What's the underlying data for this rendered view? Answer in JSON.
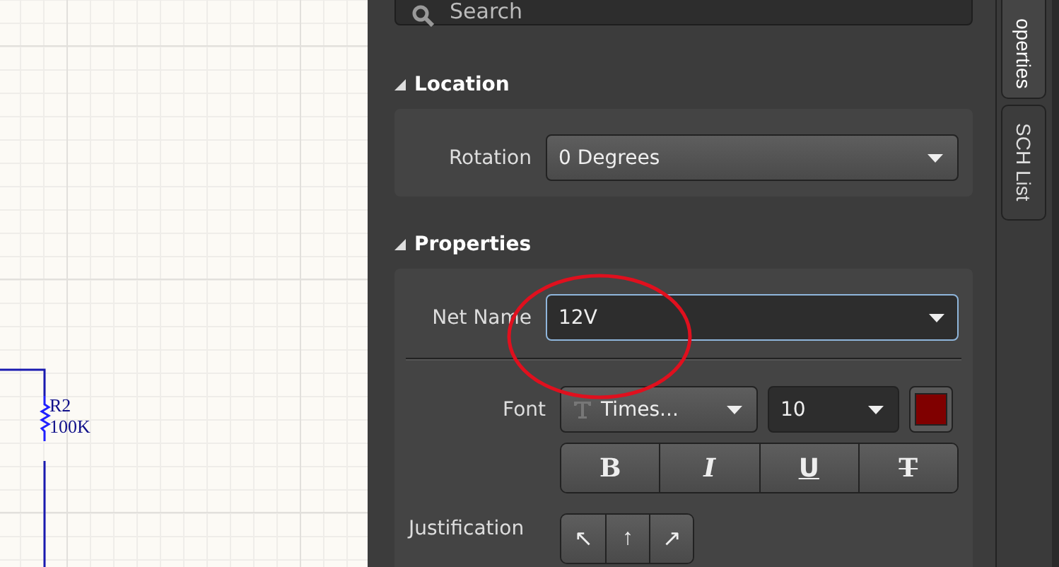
{
  "schematic": {
    "components": [
      {
        "designator": "R2",
        "value": "100K"
      }
    ]
  },
  "panel": {
    "search": {
      "placeholder": "Search"
    },
    "location": {
      "title": "Location",
      "expanded": true,
      "rotation": {
        "label": "Rotation",
        "value": "0 Degrees"
      }
    },
    "properties": {
      "title": "Properties",
      "expanded": true,
      "net_name": {
        "label": "Net Name",
        "value": "12V",
        "focused": true
      },
      "font": {
        "label": "Font",
        "family": "Times...",
        "size": "10",
        "color": "#800000",
        "styles": [
          {
            "kind": "bold",
            "label": "B"
          },
          {
            "kind": "italic",
            "label": "I"
          },
          {
            "kind": "underline",
            "label": "U"
          },
          {
            "kind": "strike",
            "label": "T"
          }
        ]
      },
      "justification": {
        "label": "Justification",
        "buttons": [
          "↖",
          "↑",
          "↗"
        ]
      }
    }
  },
  "side_tabs": [
    {
      "label": "operties",
      "selected": true
    },
    {
      "label": "SCH List",
      "selected": false
    }
  ]
}
